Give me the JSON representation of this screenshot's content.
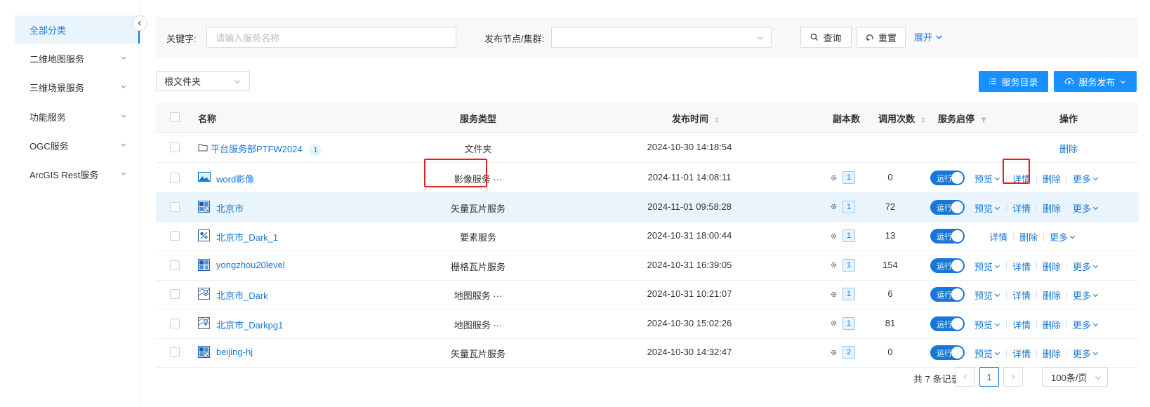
{
  "sidebar": {
    "items": [
      {
        "label": "全部分类",
        "active": true
      },
      {
        "label": "二维地图服务"
      },
      {
        "label": "三维场景服务"
      },
      {
        "label": "功能服务"
      },
      {
        "label": "OGC服务"
      },
      {
        "label": "ArcGIS Rest服务"
      }
    ]
  },
  "search": {
    "keyword_label": "关键字:",
    "keyword_placeholder": "请输入服务名称",
    "node_label": "发布节点/集群:",
    "node_value": "",
    "query_label": "查询",
    "reset_label": "重置",
    "expand_label": "展开"
  },
  "toolbar": {
    "folder_select": "根文件夹",
    "catalog_button": "服务目录",
    "publish_button": "服务发布"
  },
  "table": {
    "columns": [
      "名称",
      "服务类型",
      "发布时间",
      "副本数",
      "调用次数",
      "服务启停",
      "操作"
    ],
    "folder_row": {
      "name": "平台服务部PTFW2024",
      "count": "1",
      "type": "文件夹",
      "time": "2024-10-30 14:18:54",
      "action": "删除"
    },
    "rows": [
      {
        "name": "word影像",
        "icon": "image-icon",
        "type": "影像服务 ···",
        "time": "2024-11-01 14:08:11",
        "replicas": "1",
        "calls": "0",
        "status": "运行",
        "ops": [
          "预览",
          "详情",
          "删除",
          "更多"
        ]
      },
      {
        "name": "北京市",
        "icon": "vector-tile-icon",
        "type": "矢量瓦片服务",
        "time": "2024-11-01 09:58:28",
        "replicas": "1",
        "calls": "72",
        "status": "运行",
        "ops": [
          "预览",
          "详情",
          "删除",
          "更多"
        ]
      },
      {
        "name": "北京市_Dark_1",
        "icon": "feature-icon",
        "type": "要素服务",
        "time": "2024-10-31 18:00:44",
        "replicas": "1",
        "calls": "13",
        "status": "运行",
        "ops": [
          "详情",
          "删除",
          "更多"
        ]
      },
      {
        "name": "yongzhou20level",
        "icon": "raster-tile-icon",
        "type": "栅格瓦片服务",
        "time": "2024-10-31 16:39:05",
        "replicas": "1",
        "calls": "154",
        "status": "运行",
        "ops": [
          "预览",
          "详情",
          "删除",
          "更多"
        ]
      },
      {
        "name": "北京市_Dark",
        "icon": "map-icon",
        "type": "地图服务 ···",
        "time": "2024-10-31 10:21:07",
        "replicas": "1",
        "calls": "6",
        "status": "运行",
        "ops": [
          "预览",
          "详情",
          "删除",
          "更多"
        ]
      },
      {
        "name": "北京市_Darkpg1",
        "icon": "map-icon",
        "type": "地图服务 ···",
        "time": "2024-10-30 15:02:26",
        "replicas": "1",
        "calls": "81",
        "status": "运行",
        "ops": [
          "预览",
          "详情",
          "删除",
          "更多"
        ]
      },
      {
        "name": "beijing-hj",
        "icon": "vector-tile-icon",
        "type": "矢量瓦片服务",
        "time": "2024-10-30 14:32:47",
        "replicas": "2",
        "calls": "0",
        "status": "运行",
        "ops": [
          "预览",
          "详情",
          "删除",
          "更多"
        ]
      }
    ]
  },
  "pagination": {
    "total": "共 7 条记录",
    "current": "1",
    "page_size": "100条/页"
  },
  "colors": {
    "accent": "#1677d6",
    "highlight": "#e02020"
  }
}
